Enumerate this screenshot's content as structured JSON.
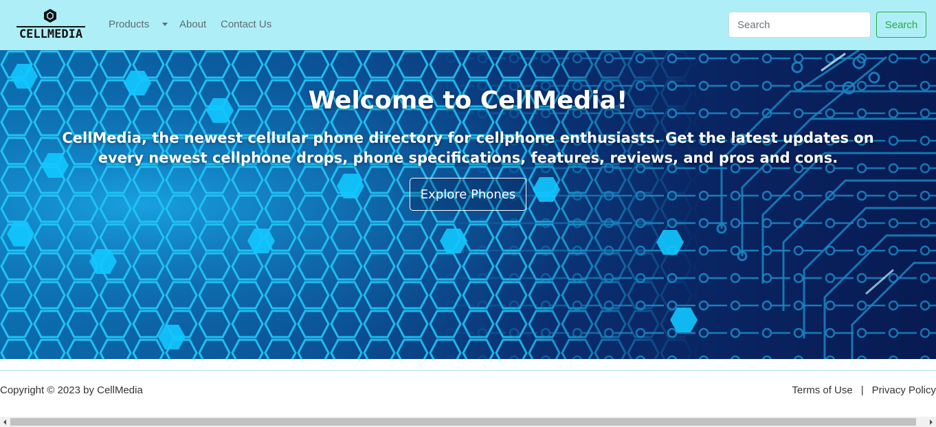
{
  "brand": {
    "logo_text": "CELLMEDIA",
    "logo_icon": "hexagon-chip-icon"
  },
  "nav": {
    "products_label": "Products",
    "about_label": "About",
    "contact_label": "Contact Us"
  },
  "search": {
    "placeholder": "Search",
    "value": "",
    "button_label": "Search"
  },
  "hero": {
    "title": "Welcome to CellMedia!",
    "text": "CellMedia, the newest cellular phone directory for cellphone enthusiasts. Get the latest updates on every newest cellphone drops, phone specifications, features, reviews, and pros and cons.",
    "button_label": "Explore Phones"
  },
  "footer": {
    "copyright": "Copyright © 2023 by CellMedia",
    "terms_label": "Terms of Use",
    "separator": "|",
    "privacy_label": "Privacy Policy"
  },
  "colors": {
    "navbar_bg": "#aeeff7",
    "search_button": "#28a745",
    "hero_hex": "#00c8ff",
    "hero_dark": "#081a52"
  }
}
